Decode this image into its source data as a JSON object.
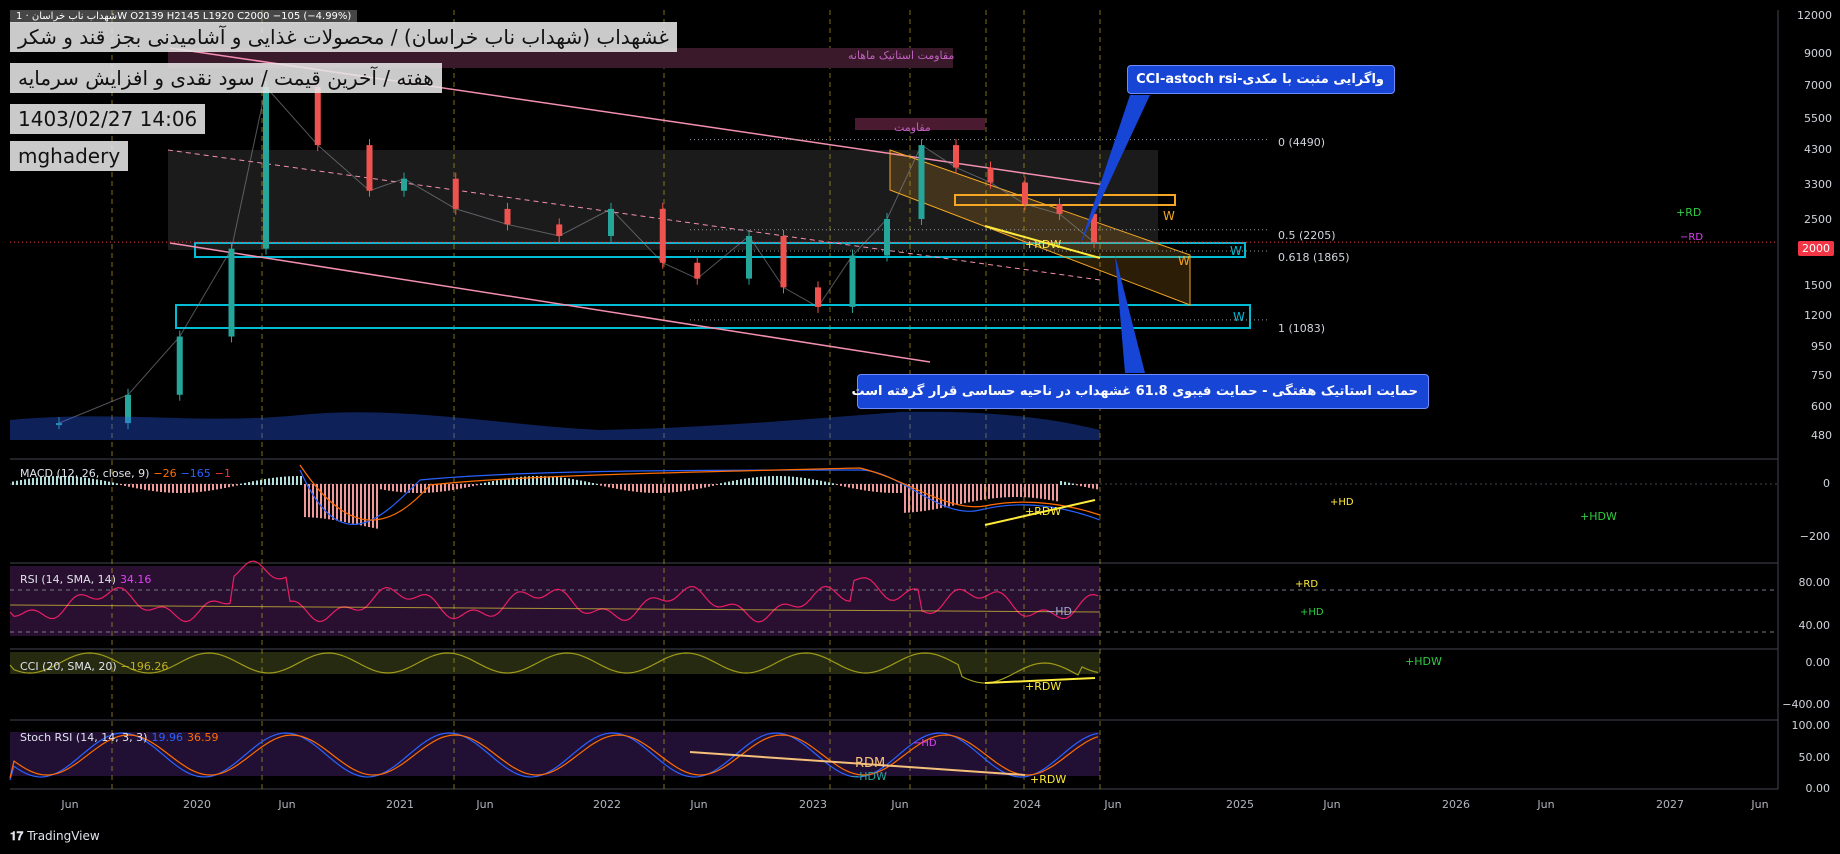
{
  "header": {
    "symbol_line": "شهداب ناب خراسان · 1W  O2139  H2145  L1920  C2000  −105 (−4.99%)",
    "title_line1": "غشهداب (شهداب ناب خراسان) / محصولات غذایی و آشامیدنی بجز قند و شکر",
    "title_line2": "هفته / آخرین قیمت / سود نقدی و افزایش سرمایه",
    "datetime": "1403/02/27 14:06",
    "author": "mghadery"
  },
  "callouts": {
    "top": "واگرایی مثبت با مکدی-CCI-astoch rsi",
    "bottom": "حمایت استاتیک هفتگی - حمایت فیبوی 61.8 غشهداب در ناحیه حساسی قرار گرفته است"
  },
  "zone_labels": {
    "monthly_resistance": "مقاومت استاتیک ماهانه",
    "resistance": "مقاومت"
  },
  "price_axis": [
    "12000",
    "9000",
    "7000",
    "5500",
    "4300",
    "3300",
    "2500",
    "1500",
    "1200",
    "950",
    "750",
    "600",
    "480"
  ],
  "current_price": "2000",
  "fib_levels": [
    {
      "label": "0 (4490)",
      "price": 4490
    },
    {
      "label": "0.5 (2205)",
      "price": 2205
    },
    {
      "label": "0.618 (1865)",
      "price": 1865
    },
    {
      "label": "1 (1083)",
      "price": 1083
    }
  ],
  "time_axis": [
    "Jun",
    "2020",
    "Jun",
    "2021",
    "Jun",
    "2022",
    "Jun",
    "2023",
    "Jun",
    "2024",
    "Jun",
    "2025",
    "Jun",
    "2026",
    "Jun",
    "2027",
    "Jun"
  ],
  "indicators": {
    "macd": {
      "label": "MACD (12, 26, close, 9)",
      "v1": "−26",
      "v2": "−165",
      "v3": "−1",
      "ticks": [
        "0",
        "−200"
      ]
    },
    "rsi": {
      "label": "RSI (14, SMA, 14)",
      "value": "34.16",
      "ticks": [
        "80.00",
        "40.00"
      ]
    },
    "cci": {
      "label": "CCI (20, SMA, 20)",
      "value": "−196.26",
      "ticks": [
        "0.00",
        "−400.00"
      ]
    },
    "stoch": {
      "label": "Stoch RSI (14, 14, 3, 3)",
      "k": "19.96",
      "d": "36.59",
      "ticks": [
        "100.00",
        "50.00",
        "0.00"
      ]
    }
  },
  "annotations": {
    "rdw": "+RDW",
    "rdm": "RDM",
    "hdw_neg": "−HDW",
    "hd_neg": "−HD",
    "hd_pos": "+HD",
    "rd_pos": "+RD",
    "rd_neg": "−RD",
    "hdw_pos": "+HDW",
    "w": "W"
  },
  "colors": {
    "up_candle": "#26a69a",
    "down_candle": "#ef5350",
    "channel": "#f48fb1",
    "support_zone": "#00bcd4",
    "orange_channel": "#f5a623",
    "callout": "#1746d6",
    "macd": "#2962ff",
    "signal": "#ff6d00",
    "rsi": "#b33fd6",
    "cci": "#9e9a1a",
    "stoch_k": "#2962ff",
    "stoch_d": "#ff6d00",
    "price_tag": "#f23645"
  },
  "watermark": "TradingView",
  "chart_data": {
    "type": "line",
    "title": "غشهداب",
    "scale": "log",
    "ylim": [
      420,
      12000
    ],
    "x": [
      "2019-05",
      "2019-09",
      "2019-12",
      "2020-03",
      "2020-05",
      "2020-08",
      "2020-11",
      "2021-01",
      "2021-04",
      "2021-07",
      "2021-10",
      "2022-01",
      "2022-04",
      "2022-06",
      "2022-09",
      "2022-11",
      "2023-01",
      "2023-03",
      "2023-05",
      "2023-07",
      "2023-09",
      "2023-11",
      "2024-01",
      "2024-03",
      "2024-05"
    ],
    "series": [
      {
        "name": "Close",
        "values": [
          480,
          600,
          950,
          1900,
          6800,
          4300,
          3000,
          3300,
          2600,
          2300,
          2100,
          2600,
          1700,
          1500,
          2100,
          1400,
          1200,
          1800,
          2400,
          4300,
          3600,
          3200,
          2700,
          2500,
          2000
        ]
      }
    ]
  }
}
